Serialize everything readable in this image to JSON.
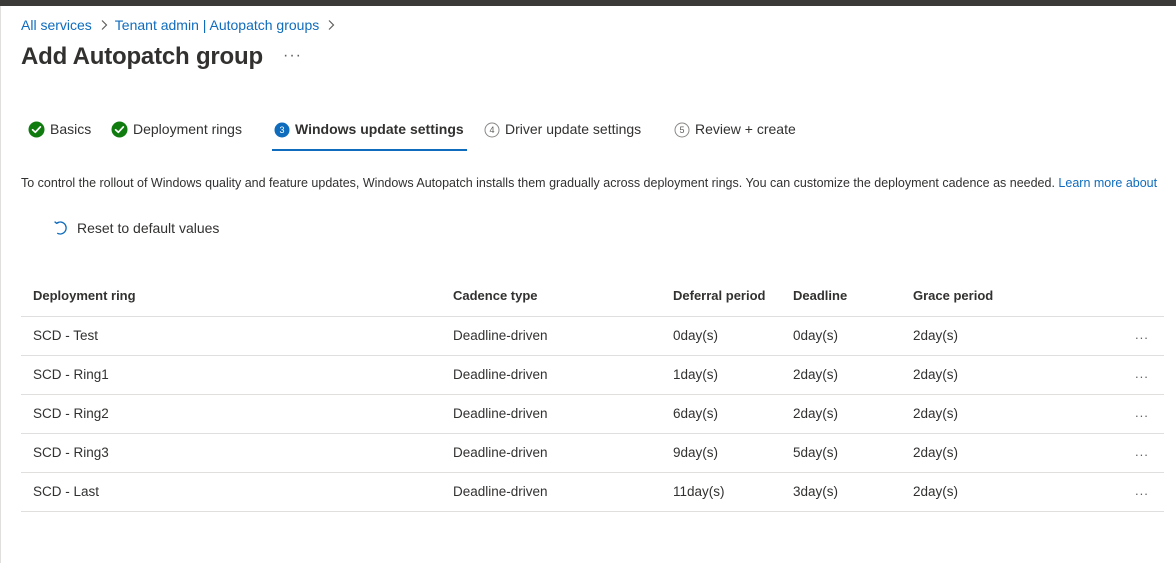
{
  "breadcrumb": {
    "items": [
      {
        "label": "All services"
      },
      {
        "label": "Tenant admin | Autopatch groups"
      }
    ]
  },
  "page": {
    "title": "Add Autopatch group",
    "more_label": "···"
  },
  "wizard": {
    "tabs": [
      {
        "label": "Basics",
        "state": "completed",
        "icon": "check-circle-icon"
      },
      {
        "label": "Deployment rings",
        "state": "completed",
        "icon": "check-circle-icon"
      },
      {
        "label": "Windows update settings",
        "state": "active",
        "step": "3"
      },
      {
        "label": "Driver update settings",
        "state": "upcoming",
        "step": "4"
      },
      {
        "label": "Review + create",
        "state": "upcoming",
        "step": "5"
      }
    ]
  },
  "description": {
    "text": "To control the rollout of Windows quality and feature updates, Windows Autopatch installs them gradually across deployment rings. You can customize the deployment cadence as needed.",
    "link": "Learn more about"
  },
  "toolbar": {
    "reset_label": "Reset to default values",
    "reset_icon": "undo-icon"
  },
  "table": {
    "columns": [
      "Deployment ring",
      "Cadence type",
      "Deferral period",
      "Deadline",
      "Grace period"
    ],
    "rows": [
      {
        "ring": "SCD - Test",
        "cadence": "Deadline-driven",
        "deferral": "0day(s)",
        "deadline": "0day(s)",
        "grace": "2day(s)"
      },
      {
        "ring": "SCD - Ring1",
        "cadence": "Deadline-driven",
        "deferral": "1day(s)",
        "deadline": "2day(s)",
        "grace": "2day(s)"
      },
      {
        "ring": "SCD - Ring2",
        "cadence": "Deadline-driven",
        "deferral": "6day(s)",
        "deadline": "2day(s)",
        "grace": "2day(s)"
      },
      {
        "ring": "SCD - Ring3",
        "cadence": "Deadline-driven",
        "deferral": "9day(s)",
        "deadline": "5day(s)",
        "grace": "2day(s)"
      },
      {
        "ring": "SCD - Last",
        "cadence": "Deadline-driven",
        "deferral": "11day(s)",
        "deadline": "3day(s)",
        "grace": "2day(s)"
      }
    ],
    "row_more_label": "..."
  },
  "colors": {
    "accent": "#0f6cbd",
    "success": "#107c10",
    "text": "#323130",
    "divider": "#e1dfdd"
  }
}
